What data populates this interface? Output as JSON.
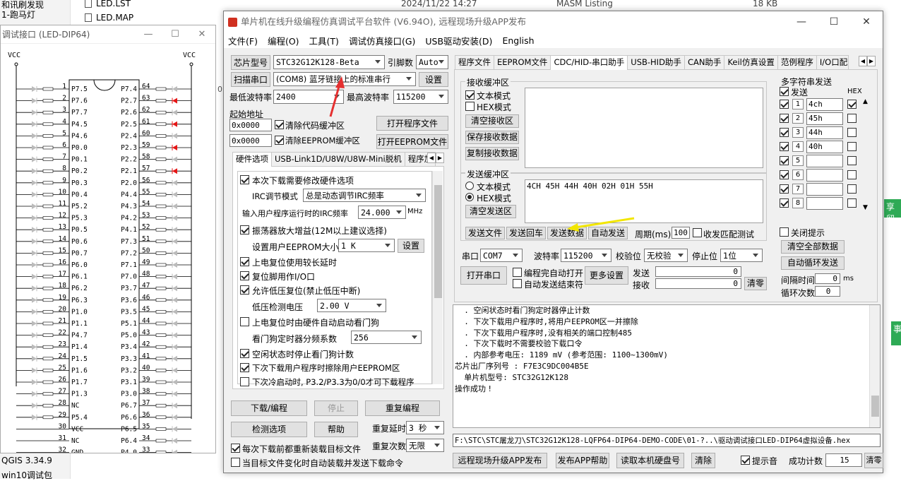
{
  "explorer": {
    "left_items": [
      "和讯刷发现",
      "1-跑马灯",
      "QGIS 3.34.9",
      "win10调试包"
    ],
    "files": [
      {
        "name": "LED.LST",
        "date": "2024/11/22 14:27",
        "type": "MASM Listing",
        "size": "18 KB"
      },
      {
        "name": "LED.MAP",
        "date": "",
        "type": "",
        "size": ""
      }
    ],
    "side_char": "0",
    "right_badges": [
      "享留",
      "事"
    ]
  },
  "schematic": {
    "title": "调试接口 (LED-DIP64)",
    "vcc": "VCC",
    "left_pins": [
      "1",
      "2",
      "3",
      "4",
      "5",
      "6",
      "7",
      "8",
      "9",
      "10",
      "11",
      "12",
      "13",
      "14",
      "15",
      "16",
      "17",
      "18",
      "19",
      "20",
      "21",
      "22",
      "23",
      "24",
      "25",
      "26",
      "27",
      "28",
      "29",
      "30",
      "31",
      "32"
    ],
    "left_names": [
      "P7.5",
      "P7.6",
      "P7.7",
      "P4.5",
      "P4.6",
      "P0.0",
      "P0.1",
      "P0.2",
      "P0.3",
      "P0.4",
      "P5.2",
      "P5.3",
      "P0.5",
      "P0.6",
      "P0.7",
      "P6.0",
      "P6.1",
      "P6.2",
      "P6.3",
      "P1.0",
      "P1.1",
      "P4.7",
      "P1.4",
      "P1.5",
      "P1.6",
      "P1.7",
      "P1.3",
      "NC",
      "P5.4",
      "VCC",
      "NC",
      "GND"
    ],
    "right_pins": [
      "64",
      "63",
      "62",
      "61",
      "60",
      "59",
      "58",
      "57",
      "56",
      "55",
      "54",
      "53",
      "52",
      "51",
      "50",
      "49",
      "48",
      "47",
      "46",
      "45",
      "44",
      "43",
      "42",
      "41",
      "40",
      "39",
      "38",
      "37",
      "36",
      "35",
      "34",
      "33"
    ],
    "right_names": [
      "P7.4",
      "P2.7",
      "P2.6",
      "P2.5",
      "P2.4",
      "P2.3",
      "P2.2",
      "P2.1",
      "P2.0",
      "P4.4",
      "P4.3",
      "P4.2",
      "P4.1",
      "P7.3",
      "P7.2",
      "P7.1",
      "P7.0",
      "P3.7",
      "P3.6",
      "P3.5",
      "P5.1",
      "P5.0",
      "P3.4",
      "P3.3",
      "P3.2",
      "P3.1",
      "P3.0",
      "P6.7",
      "P6.6",
      "P6.5",
      "P6.4",
      "P4.0"
    ],
    "lit_right": [
      1,
      3,
      5,
      7
    ]
  },
  "app": {
    "title": "单片机在线升级编程仿真调试平台软件 (V6.94O), 远程现场升级APP发布",
    "menu": [
      "文件(F)",
      "编程(O)",
      "工具(T)",
      "调试仿真接口(G)",
      "USB驱动安装(D)",
      "English"
    ],
    "chip_btn": "芯片型号",
    "chip_value": "STC32G12K128-Beta",
    "pin_label": "引脚数",
    "pin_value": "Auto",
    "scan_btn": "扫描串口",
    "port_value": "(COM8) 蓝牙链接上的标准串行",
    "settings_btn": "设置",
    "min_baud_label": "最低波特率",
    "min_baud": "2400",
    "max_baud_label": "最高波特率",
    "max_baud": "115200",
    "start_addr_label": "起始地址",
    "addr1": "0x0000",
    "clear_code_label": "清除代码缓冲区",
    "open_prog_btn": "打开程序文件",
    "addr2": "0x0000",
    "clear_eeprom_label": "清除EEPROM缓冲区",
    "open_eeprom_btn": "打开EEPROM文件",
    "hw_tabs": [
      "硬件选项",
      "USB-Link1D/U8W/U8W-Mini脱机",
      "程序加"
    ],
    "hw_options": [
      {
        "label": "本次下载需要修改硬件选项",
        "checked": true
      },
      {
        "label": "IRC调节模式",
        "value": "总是动态调节IRC频率"
      },
      {
        "label": "输入用户程序运行时的IRC频率",
        "value": "24.000",
        "unit": "MHz"
      },
      {
        "label": "振荡器放大增益(12M以上建议选择)",
        "checked": true
      },
      {
        "label": "设置用户EEPROM大小",
        "value": "1   K",
        "btn": "设置"
      },
      {
        "label": "上电复位使用较长延时",
        "checked": true
      },
      {
        "label": "复位脚用作I/O口",
        "checked": true
      },
      {
        "label": "允许低压复位(禁止低压中断)",
        "checked": true
      },
      {
        "label": "低压检测电压",
        "value": "2.00 V"
      },
      {
        "label": "上电复位时由硬件自动启动看门狗",
        "checked": false
      },
      {
        "label": "看门狗定时器分频系数",
        "value": "256"
      },
      {
        "label": "空闲状态时停止看门狗计数",
        "checked": true
      },
      {
        "label": "下次下载用户程序时擦除用户EEPROM区",
        "checked": true
      },
      {
        "label": "下次冷启动时, P3.2/P3.3为0/0才可下载程序",
        "checked": false
      }
    ],
    "download_btn": "下载/编程",
    "stop_btn": "停止",
    "reprog_btn": "重复编程",
    "detect_btn": "检测选项",
    "help_btn": "帮助",
    "delay_label": "重复延时",
    "delay_value": "3 秒",
    "count_label": "重复次数",
    "count_value": "无限",
    "reload_label": "每次下载前都重新装载目标文件",
    "autoload_label": "当目标文件变化时自动装载并发送下载命令",
    "main_tabs": [
      "程序文件",
      "EEPROM文件",
      "CDC/HID-串口助手",
      "USB-HID助手",
      "CAN助手",
      "Keil仿真设置",
      "范例程序",
      "I/O口配置"
    ],
    "recv_group": "接收缓冲区",
    "text_mode": "文本模式",
    "hex_mode": "HEX模式",
    "clear_recv_btn": "清空接收区",
    "save_recv_btn": "保存接收数据",
    "copy_recv_btn": "复制接收数据",
    "send_group": "发送缓冲区",
    "send_text_mode": "文本模式",
    "send_hex_mode": "HEX模式",
    "clear_send_btn": "清空发送区",
    "send_content": "4CH 45H 44H 40H 02H 01H 55H",
    "send_file_btn": "发送文件",
    "send_cr_btn": "发送回车",
    "send_data_btn": "发送数据",
    "auto_send_btn": "自动发送",
    "period_label": "周期(ms)",
    "period_value": "100",
    "match_label": "收发匹配测试",
    "com_label": "串口",
    "com_value": "COM7",
    "baud_label": "波特率",
    "baud_value": "115200",
    "parity_label": "校验位",
    "parity_value": "无校验",
    "stop_label": "停止位",
    "stop_value": "1位",
    "open_port_btn": "打开串口",
    "auto_open_label": "编程完自动打开",
    "auto_send_end_label": "自动发送结束符",
    "more_btn": "更多设置",
    "send_count_label": "发送",
    "send_count": "0",
    "recv_count_label": "接收",
    "recv_count": "0",
    "clear_count_btn": "清零",
    "multi_title": "多字符串发送",
    "multi_send_label": "发送",
    "multi_hex_label": "HEX",
    "multi_rows": [
      {
        "n": "1",
        "v": "4ch",
        "hex": true
      },
      {
        "n": "2",
        "v": "45h",
        "hex": false
      },
      {
        "n": "3",
        "v": "44h",
        "hex": false
      },
      {
        "n": "4",
        "v": "40h",
        "hex": false
      },
      {
        "n": "5",
        "v": "",
        "hex": false
      },
      {
        "n": "6",
        "v": "",
        "hex": false
      },
      {
        "n": "7",
        "v": "",
        "hex": false
      },
      {
        "n": "8",
        "v": "",
        "hex": false
      }
    ],
    "close_tip_label": "关闭提示",
    "clear_all_btn": "清空全部数据",
    "auto_loop_btn": "自动循环发送",
    "interval_label": "间隔时间",
    "interval_value": "0",
    "interval_unit": "ms",
    "loop_label": "循环次数",
    "loop_value": "0",
    "log_lines": [
      "  . 空闲状态时看门狗定时器停止计数",
      "  . 下次下载用户程序时,将用户EEPROM区一并擦除",
      "  . 下次下载用户程序时,没有相关的端口控制485",
      "  . 下次下载时不需要校验下载口令",
      "  . 内部参考电压: 1189 mV (参考范围: 1100~1300mV)",
      "芯片出厂序列号 : F7E3C9DC004B5E",
      "",
      "  单片机型号: STC32G12K128",
      "",
      "操作成功 !"
    ],
    "path": "F:\\STC\\STC屠龙刀\\STC32G12K128-LQFP64-DIP64-DEMO-CODE\\01-?..\\驱动调试接口LED-DIP64虚拟设备.hex",
    "remote_btn": "远程现场升级APP发布",
    "publish_help_btn": "发布APP帮助",
    "read_disk_btn": "读取本机硬盘号",
    "clear_btn": "清除",
    "sound_label": "提示音",
    "success_label": "成功计数",
    "success_value": "15",
    "clear_success_btn": "清零"
  }
}
